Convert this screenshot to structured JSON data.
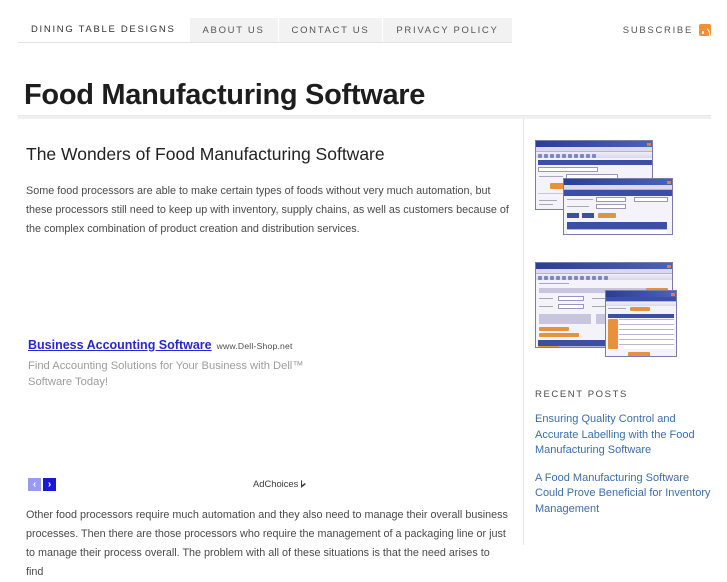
{
  "nav": {
    "items": [
      {
        "label": "Dining Table Designs",
        "active": true
      },
      {
        "label": "About Us",
        "active": false
      },
      {
        "label": "Contact Us",
        "active": false
      },
      {
        "label": "Privacy Policy",
        "active": false
      }
    ],
    "subscribe_label": "Subscribe",
    "subscribe_icon": "rss-icon"
  },
  "header": {
    "site_title": "Food Manufacturing Software"
  },
  "main": {
    "post_title": "The Wonders of Food Manufacturing Software",
    "paragraph_1": "Some food processors are able to make certain types of foods without very much automation, but these processors still need to keep up with inventory, supply chains, as well as customers because of the complex combination of product creation and distribution services.",
    "paragraph_2": "Other food processors require much automation and they also need to manage their overall business processes. Then there are those processors who require the management of a packaging line or just to manage their process overall. The problem with all of these situations is that the need arises to find"
  },
  "ad": {
    "headline": "Business Accounting Software",
    "url": "www.Dell-Shop.net",
    "description": "Find Accounting Solutions for Your Business with Dell™ Software Today!",
    "prev_label": "‹",
    "next_label": "›",
    "adchoices_label": "AdChoices",
    "adchoices_icon": "adchoices-triangle-icon"
  },
  "sidebar": {
    "thumbnails": [
      {
        "name": "software-screenshot-thumbnail-1",
        "alt": "Food manufacturing software screenshot"
      },
      {
        "name": "software-screenshot-thumbnail-2",
        "alt": "Inventory management software screenshot"
      }
    ],
    "widget_title": "Recent Posts",
    "recent_posts": [
      "Ensuring Quality Control and Accurate Labelling with the Food Manufacturing Software",
      "A Food Manufacturing Software Could Prove Beneficial for Inventory Management"
    ]
  },
  "colors": {
    "nav_bg": "#f2f2f2",
    "link": "#3b6ea8",
    "ad_link": "#2727d0",
    "rss_orange": "#f29033",
    "next_arrow": "#1818d8",
    "prev_arrow": "#9a9aef"
  }
}
